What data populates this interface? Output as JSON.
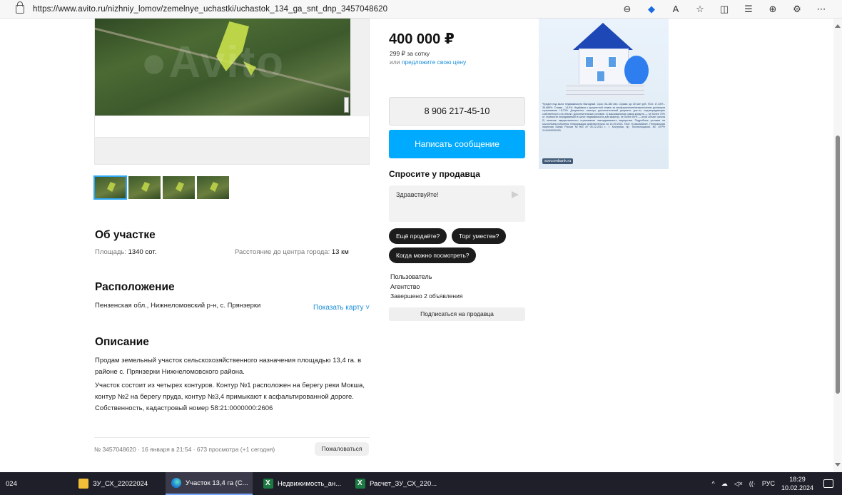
{
  "browser": {
    "url": "https://www.avito.ru/nizhniy_lomov/zemelnye_uchastki/uchastok_134_ga_snt_dnp_3457048620",
    "toolbar_glyphs": {
      "zoom": "⊖",
      "read_aloud": "A",
      "favorite": "☆",
      "split": "◫",
      "favorites_list": "☰",
      "collections": "⊕",
      "extensions": "⚙",
      "menu": "⋯"
    }
  },
  "listing": {
    "thumbnails_count": 4,
    "about": {
      "title": "Об участке",
      "area_label": "Площадь:",
      "area_value": "1340 сот.",
      "distance_label": "Расстояние до центра города:",
      "distance_value": "13 км"
    },
    "location": {
      "title": "Расположение",
      "address": "Пензенская обл., Нижнеломовский р-н, с. Прянзерки",
      "show_map": "Показать карту ˅"
    },
    "description": {
      "title": "Описание",
      "p1": "Продам земельный участок сельскохозяйственного назначения площадью 13,4 га. в районе с. Прянзерки Нижнеломовского района.",
      "p2": "Участок состоит из четырех контуров. Контур №1 расположен на берегу реки Мокша, контур №2 на берегу пруда, контур №3,4 примыкают к асфальтированной дороге. Собственность, кадастровый номер 58:21:0000000:2606"
    },
    "meta": "№ 3457048620 · 16 января в 21:54 · 673 просмотра (+1 сегодня)",
    "complain_label": "Пожаловаться"
  },
  "sidebar": {
    "price": "400 000 ₽",
    "price_per_unit": "299 ₽ за сотку",
    "offer_prefix": "или ",
    "offer_link": "предложите свою цену",
    "phone": "8 906 217-45-10",
    "message_button": "Написать сообщение",
    "ask_title": "Спросите у продавца",
    "ask_placeholder": "Здравствуйте!",
    "quick_questions": [
      "Ещё продаёте?",
      "Торг уместен?",
      "Когда можно посмотреть?"
    ],
    "seller": {
      "name": "Пользователь",
      "type": "Агентство",
      "completed": "Завершено 2 объявления"
    },
    "subscribe_label": "Подписаться на продавца"
  },
  "ad": {
    "text": "*Кредит под залог недвижимости Выгодный. Срок: 36-180 мес. Сумма: до 30 млн руб. ПСК: 17,33% - 35,685%. Ставка - 14,9%. Надбавка к процентной ставке за неоформление/незаключение договоров страхования +8,73%. Документы: паспорт, дополнительный документ, док-ты, подтверждающие собственность на объект. Дополнительные условия: 1) максимальная сумма кредита — не более 70% от стоимости передаваемой в залог недвижимости для квартир, не более 60% — иной объект залога 2) наличие имущественного страхования закладываемого имущества. Подробные условия на sovcombank.ru/ipoteka. Информация действительна на 14.09.2023. ПАО «Совкомбанк». Генеральная лицензия Банка России №963 от 05.12.2014 г., г. Кострома, пр. Текстильщиков, 46, ОГРН 1144400000425.",
    "logo": "sovcombank.ru"
  },
  "taskbar": {
    "cut_left": "024",
    "items": [
      {
        "label": "ЗУ_СХ_22022024",
        "icon": "folder-icon"
      },
      {
        "label": "Участок 13,4 га (С...",
        "icon": "edge-icon"
      },
      {
        "label": "Недвижимость_ан...",
        "icon": "excel-icon"
      },
      {
        "label": "Расчет_ЗУ_СХ_220...",
        "icon": "excel-icon"
      }
    ],
    "tray": {
      "lang": "РУС",
      "time": "18:29",
      "date": "10.02.2024",
      "glyphs": {
        "chevron": "^",
        "cloud": "☁",
        "speaker": "◁×",
        "wifi": "((·"
      }
    }
  }
}
